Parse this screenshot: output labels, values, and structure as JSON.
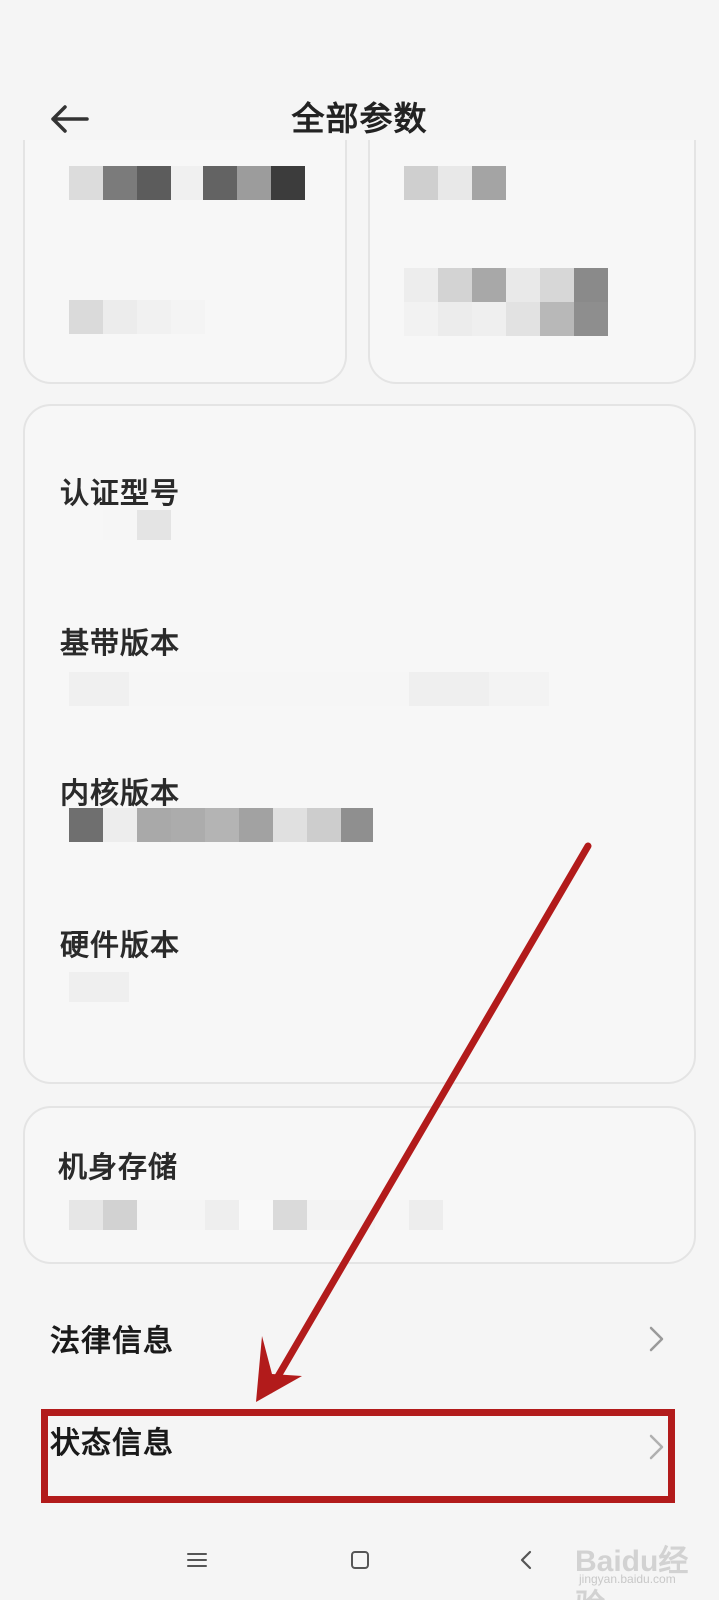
{
  "header": {
    "title": "全部参数",
    "back_icon": "arrow-left-icon"
  },
  "specs": {
    "items": [
      {
        "label": "认证型号"
      },
      {
        "label": "基带版本"
      },
      {
        "label": "内核版本"
      },
      {
        "label": "硬件版本"
      }
    ],
    "storage_label": "机身存储"
  },
  "rows": [
    {
      "label": "法律信息",
      "icon": "chevron-right-icon"
    },
    {
      "label": "状态信息",
      "icon": "chevron-right-icon"
    }
  ],
  "annotation": {
    "color": "#b21b1b",
    "target": "状态信息"
  },
  "navbar": {
    "menu_icon": "menu-icon",
    "home_icon": "home-square-icon",
    "back_icon": "back-triangle-icon"
  },
  "watermark": {
    "text": "Baidu经验",
    "sub": "jingyan.baidu.com"
  }
}
